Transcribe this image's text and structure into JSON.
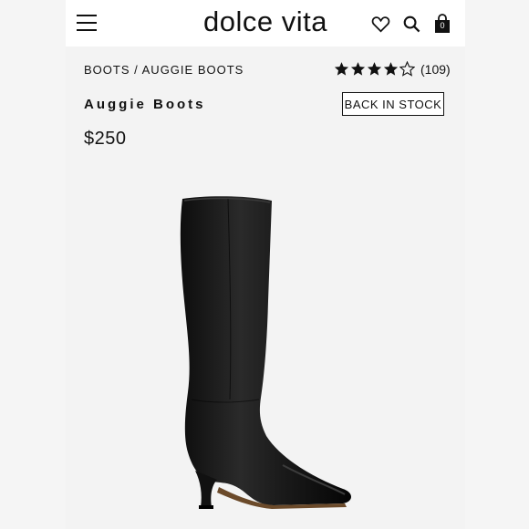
{
  "header": {
    "logo": "dolce vita",
    "bag_count": "0",
    "icons": [
      "menu-icon",
      "heart-icon",
      "search-icon",
      "bag-icon"
    ]
  },
  "breadcrumb": {
    "category": "BOOTS",
    "separator": " / ",
    "current": "AUGGIE BOOTS"
  },
  "rating": {
    "stars_filled": 4,
    "stars_total": 5,
    "review_count": "(109)"
  },
  "product": {
    "title": "Auggie Boots",
    "price": "$250",
    "stock_button": "BACK IN STOCK",
    "color": "#111111"
  }
}
